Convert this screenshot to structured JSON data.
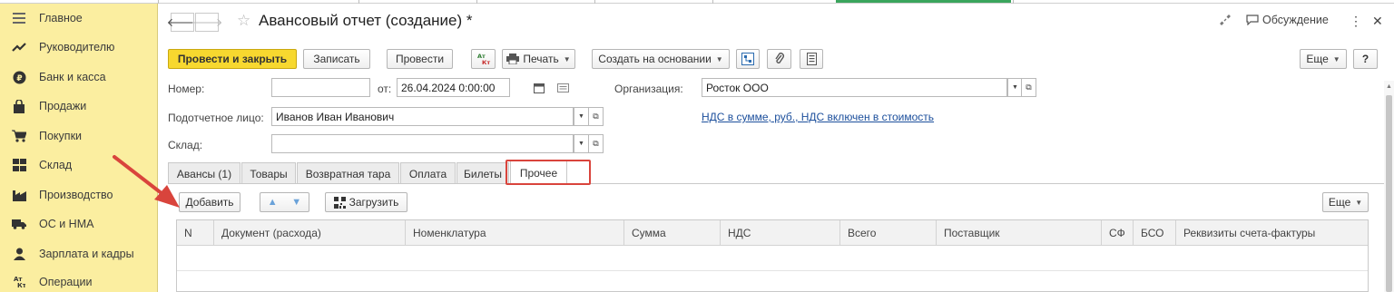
{
  "sidebar": {
    "items": [
      {
        "label": "Главное",
        "icon": "menu-icon"
      },
      {
        "label": "Руководителю",
        "icon": "trend-icon"
      },
      {
        "label": "Банк и касса",
        "icon": "ruble-coin-icon"
      },
      {
        "label": "Продажи",
        "icon": "shopping-bag-icon"
      },
      {
        "label": "Покупки",
        "icon": "cart-icon"
      },
      {
        "label": "Склад",
        "icon": "warehouse-grid-icon"
      },
      {
        "label": "Производство",
        "icon": "factory-icon"
      },
      {
        "label": "ОС и НМА",
        "icon": "truck-icon"
      },
      {
        "label": "Зарплата и кадры",
        "icon": "person-icon"
      },
      {
        "label": "Операции",
        "icon": "debit-credit-icon"
      }
    ]
  },
  "header": {
    "title": "Авансовый отчет (создание) *",
    "discussion": "Обсуждение"
  },
  "toolbar": {
    "post_close": "Провести и закрыть",
    "save": "Записать",
    "post": "Провести",
    "print": "Печать",
    "create_based": "Создать на основании",
    "more": "Еще",
    "help": "?"
  },
  "form": {
    "number_label": "Номер:",
    "number_value": "",
    "date_label": "от:",
    "date_value": "26.04.2024  0:00:00",
    "org_label": "Организация:",
    "org_value": "Росток ООО",
    "person_label": "Подотчетное лицо:",
    "person_value": "Иванов Иван Иванович",
    "vat_link": "НДС в сумме, руб., НДС включен в стоимость",
    "warehouse_label": "Склад:",
    "warehouse_value": ""
  },
  "tabs": [
    {
      "label": "Авансы (1)"
    },
    {
      "label": "Товары"
    },
    {
      "label": "Возвратная тара"
    },
    {
      "label": "Оплата"
    },
    {
      "label": "Билеты"
    },
    {
      "label": "Прочее"
    }
  ],
  "table_toolbar": {
    "add": "Добавить",
    "load": "Загрузить",
    "more": "Еще"
  },
  "table": {
    "columns": [
      "N",
      "Документ (расхода)",
      "Номенклатура",
      "Сумма",
      "НДС",
      "Всего",
      "Поставщик",
      "СФ",
      "БСО",
      "Реквизиты счета-фактуры"
    ],
    "rows": []
  },
  "colors": {
    "sidebar_bg": "#fbeea0",
    "primary_button": "#f7d82f",
    "highlight": "#d9443c",
    "link": "#1c4f9c"
  }
}
